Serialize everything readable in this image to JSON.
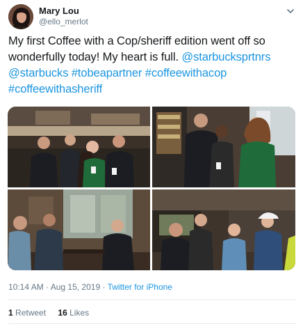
{
  "user": {
    "display_name": "Mary Lou",
    "handle": "@ello_merlot"
  },
  "tweet": {
    "text_prefix": "My first Coffee with a Cop/sheriff edition went off so wonderfully today! My heart is full. ",
    "links": [
      "@starbucksprtnrs",
      "@starbucks",
      "#tobeapartner",
      "#coffeewithacop",
      "#coffeewithasheriff"
    ]
  },
  "meta": {
    "time": "10:14 AM",
    "separator": "·",
    "date": "Aug 15, 2019",
    "source": "Twitter for iPhone"
  },
  "stats": {
    "retweets_count": "1",
    "retweets_label": "Retweet",
    "likes_count": "16",
    "likes_label": "Likes"
  },
  "colors": {
    "link": "#1b95e0",
    "secondary_text": "#657786",
    "divider": "#e6ecf0"
  },
  "icons": {
    "menu": "chevron-down-icon"
  }
}
